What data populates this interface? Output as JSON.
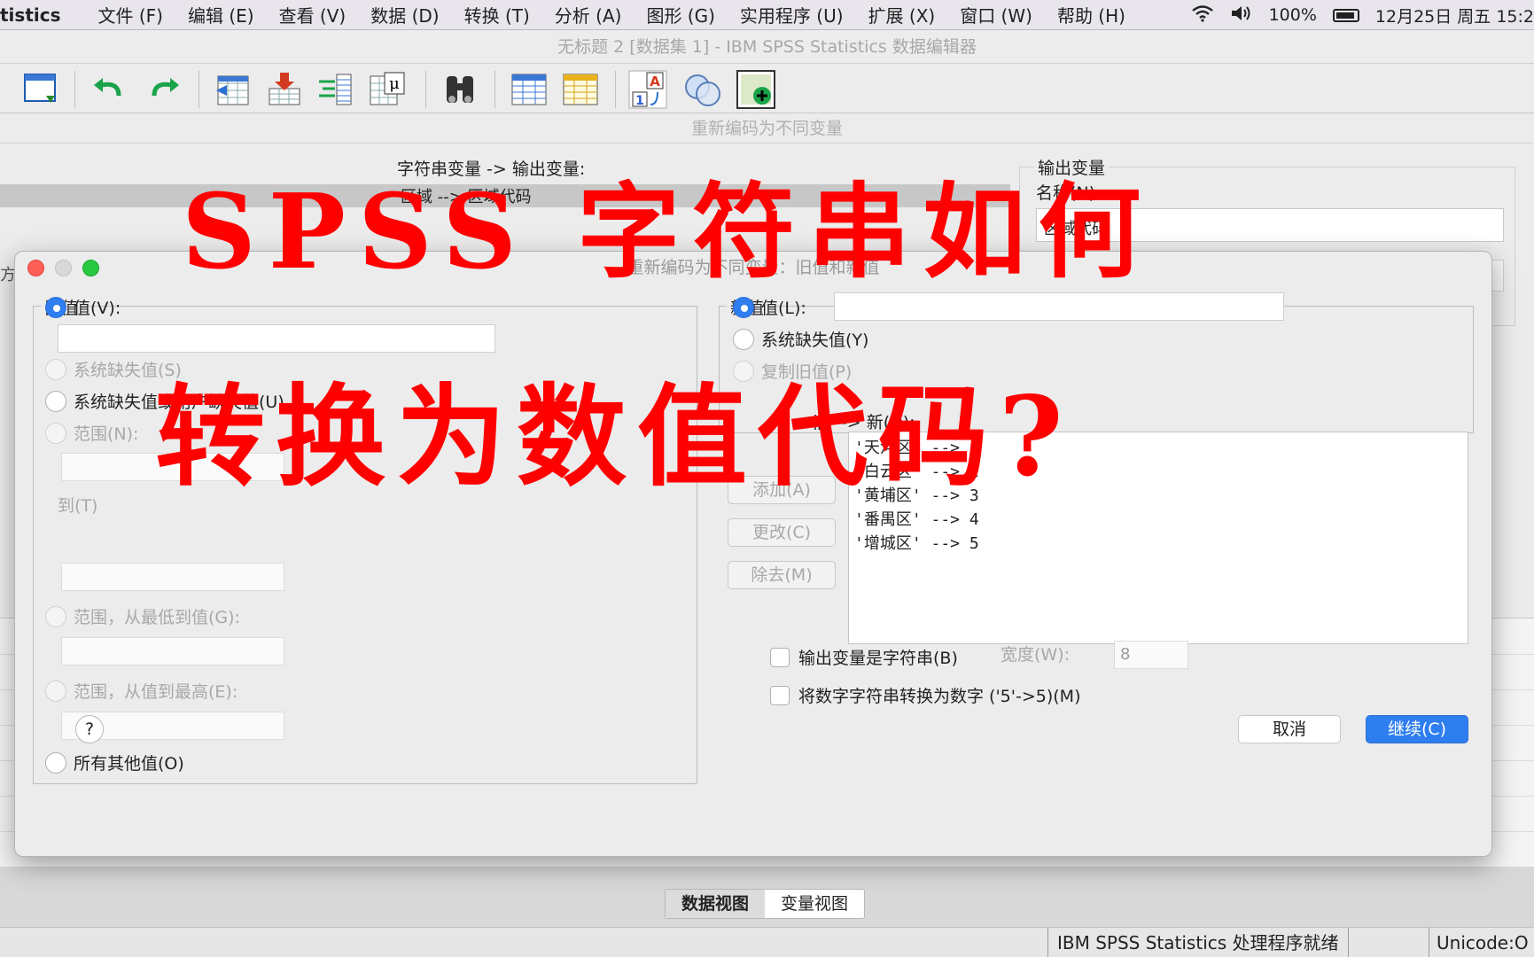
{
  "menubar": {
    "app": "tistics",
    "items": [
      "文件 (F)",
      "编辑 (E)",
      "查看 (V)",
      "数据 (D)",
      "转换 (T)",
      "分析 (A)",
      "图形 (G)",
      "实用程序 (U)",
      "扩展 (X)",
      "窗口 (W)",
      "帮助 (H)"
    ],
    "battery": "100%",
    "clock": "12月25日 周五 15:2"
  },
  "window": {
    "title": "无标题 2 [数据集 1] - IBM SPSS Statistics 数据编辑器"
  },
  "toolbar": {
    "icons": [
      "dialog-recall-icon",
      "undo-icon",
      "redo-icon",
      "goto-case-icon",
      "goto-variable-icon",
      "variables-icon",
      "statistics-mu-icon",
      "find-icon",
      "insert-cases-icon",
      "insert-variable-icon",
      "split-file-icon",
      "select-cases-icon",
      "value-labels-icon"
    ]
  },
  "bg_dialog": {
    "title": "重新编码为不同变量",
    "string_output_label": "字符串变量 -> 输出变量:",
    "mapping": "区域 --> 区域代码",
    "output_group": "输出变量",
    "name_label": "名称(N):",
    "name_value": "区域代码",
    "side_text": "方法"
  },
  "dialog": {
    "title": "重新编码为不同变量：旧值和新值",
    "old": {
      "legend": "旧值",
      "value": "值(V):",
      "system_missing": "系统缺失值(S)",
      "system_or_user_missing": "系统缺失值或用户缺失值(U)",
      "range": "范围(N):",
      "to": "到(T)",
      "range_lowest": "范围，从最低到值(G):",
      "range_highest": "范围，从值到最高(E):",
      "all_other": "所有其他值(O)"
    },
    "new": {
      "legend": "新值",
      "value": "值(L):",
      "system_missing": "系统缺失值(Y)",
      "copy_old": "复制旧值(P)"
    },
    "old_new_label": "旧 --> 新(D):",
    "mappings": [
      "'天河区' --> 1",
      "'白云区' --> 2",
      "'黄埔区' --> 3",
      "'番禺区' --> 4",
      "'增城区' --> 5"
    ],
    "buttons": {
      "add": "添加(A)",
      "change": "更改(C)",
      "remove": "除去(M)",
      "cancel": "取消",
      "continue": "继续(C)",
      "help": "?"
    },
    "output_string": "输出变量是字符串(B)",
    "width_label": "宽度(W):",
    "width_value": "8",
    "convert_numeric": "将数字字符串转换为数字 ('5'->5)(M)"
  },
  "views": {
    "data": "数据视图",
    "variable": "变量视图"
  },
  "statusbar": {
    "processor": "IBM SPSS Statistics 处理程序就绪",
    "encoding": "Unicode:O"
  },
  "overlay": {
    "line1": "SPSS 字符串如何",
    "line2": "转换为数值代码?"
  },
  "colors": {
    "accent": "#2f7ef0",
    "overlay": "#ff0000"
  }
}
